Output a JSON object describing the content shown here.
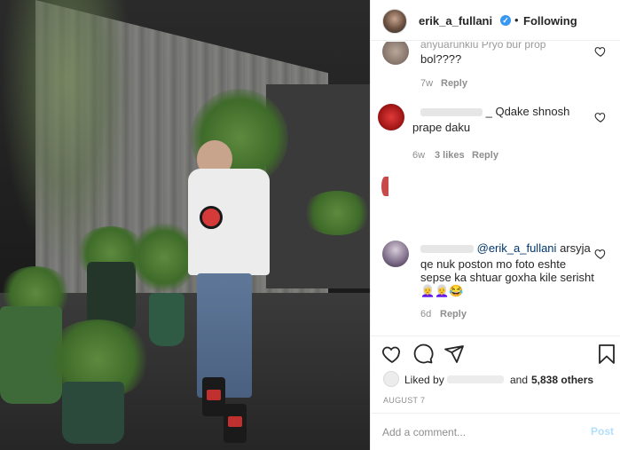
{
  "header": {
    "username": "erik_a_fullani",
    "verified_icon": "verified-badge-icon",
    "separator": "•",
    "follow_status": "Following"
  },
  "comments": [
    {
      "text": "bol????",
      "partial_top_text": "anyuarunkiu Pryo bur prop",
      "time": "7w",
      "reply": "Reply"
    },
    {
      "text_line1": "_ Qdake shnosh",
      "text_line2": "prape daku",
      "time": "6w",
      "likes": "3 likes",
      "reply": "Reply"
    },
    {
      "mention": "@erik_a_fullani",
      "text_after_mention": "arsyja",
      "text_line2": "qe nuk poston mo foto eshte",
      "text_line3": "sepse ka shtuar goxha kile serisht",
      "emojis": "👩‍🦳👩‍🦳😂",
      "time": "6d",
      "reply": "Reply"
    }
  ],
  "actions": {
    "like_icon": "heart-icon",
    "comment_icon": "comment-icon",
    "share_icon": "share-icon",
    "save_icon": "bookmark-icon"
  },
  "likes": {
    "prefix": "Liked by",
    "and": "and",
    "count": "5,838 others"
  },
  "date": "AUGUST 7",
  "add_comment": {
    "placeholder": "Add a comment...",
    "post_label": "Post"
  },
  "colors": {
    "accent": "#3897f0",
    "post_disabled": "#b2dffc",
    "muted": "#8e8e8e",
    "mention": "#00376b"
  }
}
